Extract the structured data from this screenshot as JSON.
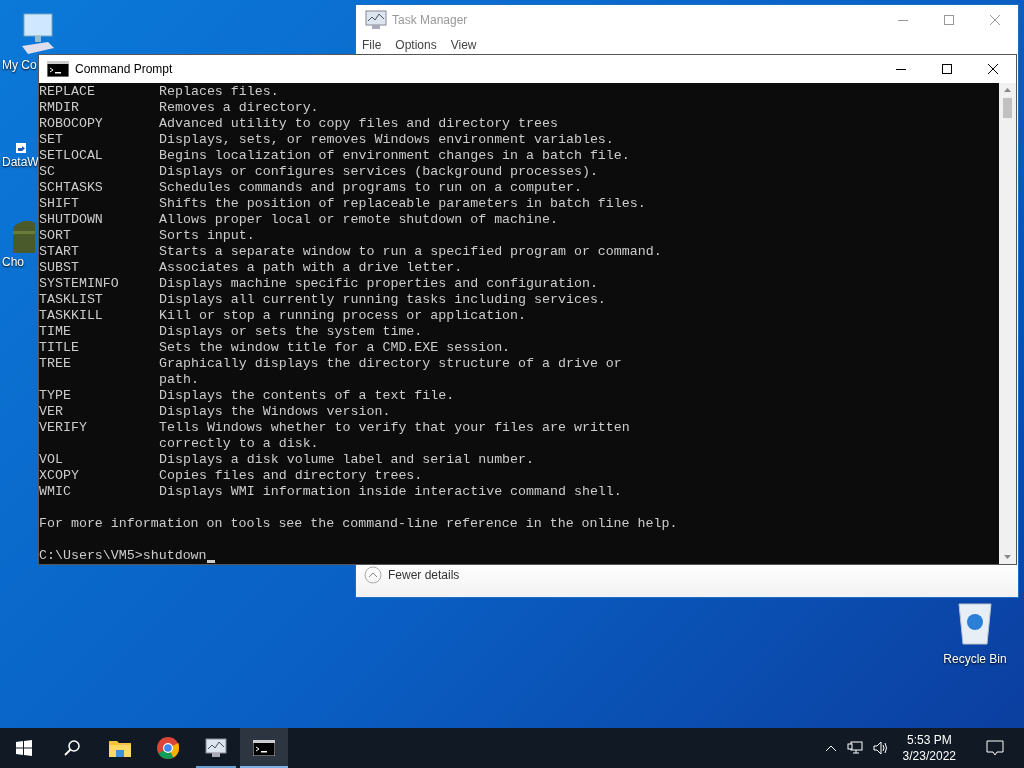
{
  "desktop_icons": [
    {
      "label": "My Co",
      "kind": "computer"
    },
    {
      "label": "DataW",
      "kind": "shortcut"
    },
    {
      "label": "Cho",
      "kind": "chest"
    }
  ],
  "task_manager": {
    "title": "Task Manager",
    "menu": [
      "File",
      "Options",
      "View"
    ],
    "footer": "Fewer details"
  },
  "command_prompt": {
    "title": "Command Prompt",
    "commands": [
      {
        "name": "REPLACE",
        "lines": [
          "Replaces files."
        ]
      },
      {
        "name": "RMDIR",
        "lines": [
          "Removes a directory."
        ]
      },
      {
        "name": "ROBOCOPY",
        "lines": [
          "Advanced utility to copy files and directory trees"
        ]
      },
      {
        "name": "SET",
        "lines": [
          "Displays, sets, or removes Windows environment variables."
        ]
      },
      {
        "name": "SETLOCAL",
        "lines": [
          "Begins localization of environment changes in a batch file."
        ]
      },
      {
        "name": "SC",
        "lines": [
          "Displays or configures services (background processes)."
        ]
      },
      {
        "name": "SCHTASKS",
        "lines": [
          "Schedules commands and programs to run on a computer."
        ]
      },
      {
        "name": "SHIFT",
        "lines": [
          "Shifts the position of replaceable parameters in batch files."
        ]
      },
      {
        "name": "SHUTDOWN",
        "lines": [
          "Allows proper local or remote shutdown of machine."
        ]
      },
      {
        "name": "SORT",
        "lines": [
          "Sorts input."
        ]
      },
      {
        "name": "START",
        "lines": [
          "Starts a separate window to run a specified program or command."
        ]
      },
      {
        "name": "SUBST",
        "lines": [
          "Associates a path with a drive letter."
        ]
      },
      {
        "name": "SYSTEMINFO",
        "lines": [
          "Displays machine specific properties and configuration."
        ]
      },
      {
        "name": "TASKLIST",
        "lines": [
          "Displays all currently running tasks including services."
        ]
      },
      {
        "name": "TASKKILL",
        "lines": [
          "Kill or stop a running process or application."
        ]
      },
      {
        "name": "TIME",
        "lines": [
          "Displays or sets the system time."
        ]
      },
      {
        "name": "TITLE",
        "lines": [
          "Sets the window title for a CMD.EXE session."
        ]
      },
      {
        "name": "TREE",
        "lines": [
          "Graphically displays the directory structure of a drive or",
          "path."
        ]
      },
      {
        "name": "TYPE",
        "lines": [
          "Displays the contents of a text file."
        ]
      },
      {
        "name": "VER",
        "lines": [
          "Displays the Windows version."
        ]
      },
      {
        "name": "VERIFY",
        "lines": [
          "Tells Windows whether to verify that your files are written",
          "correctly to a disk."
        ]
      },
      {
        "name": "VOL",
        "lines": [
          "Displays a disk volume label and serial number."
        ]
      },
      {
        "name": "XCOPY",
        "lines": [
          "Copies files and directory trees."
        ]
      },
      {
        "name": "WMIC",
        "lines": [
          "Displays WMI information inside interactive command shell."
        ]
      }
    ],
    "footer": "For more information on tools see the command-line reference in the online help.",
    "prompt": "C:\\Users\\VM5>shutdown"
  },
  "recycle_bin": {
    "label": "Recycle Bin"
  },
  "taskbar": {
    "apps": [
      {
        "kind": "start",
        "active": false,
        "running": false
      },
      {
        "kind": "search",
        "active": false,
        "running": false
      },
      {
        "kind": "explorer",
        "active": false,
        "running": false
      },
      {
        "kind": "chrome",
        "active": false,
        "running": false
      },
      {
        "kind": "taskmgr",
        "active": false,
        "running": true
      },
      {
        "kind": "cmd",
        "active": true,
        "running": true
      }
    ],
    "time": "5:53 PM",
    "date": "3/23/2022"
  }
}
